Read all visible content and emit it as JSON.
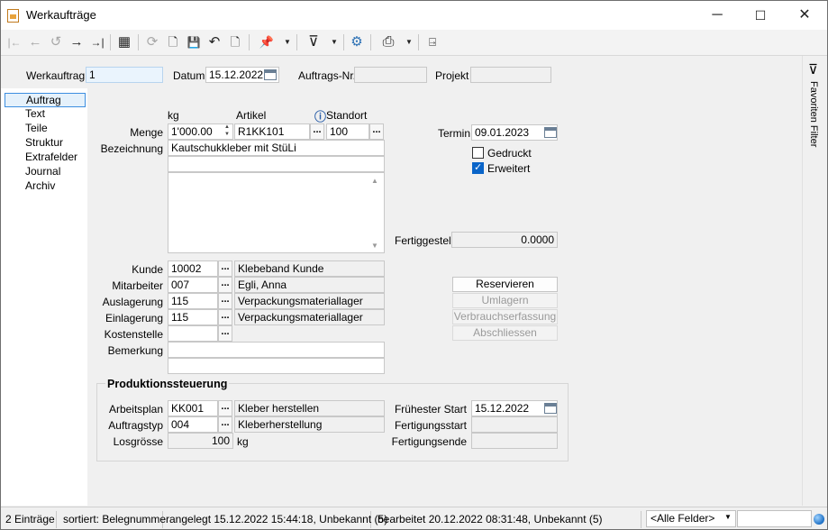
{
  "window": {
    "title": "Werkaufträge",
    "minimize": "─",
    "maximize": "☐",
    "close": "✕"
  },
  "toolbar": {
    "icons": [
      "first-record-icon",
      "previous-record-icon",
      "history-icon",
      "next-record-icon",
      "last-record-icon",
      "table-view-icon",
      "refresh-icon",
      "new-document-icon",
      "save-icon",
      "undo-icon",
      "delete-document-icon",
      "pin-icon",
      "filter-icon",
      "settings-icon",
      "print-icon",
      "exit-icon"
    ],
    "glyphs": {
      "first": "|←",
      "prev": "←",
      "history": "↺",
      "next": "→",
      "last": "→|",
      "table": "▦",
      "refresh": "⟳",
      "new": "🗋",
      "save": "💾",
      "undo": "↶",
      "delete": "🗋",
      "pin": "📌",
      "filter": "⊽",
      "settings": "⚙",
      "print": "⎙",
      "exit": "⍈",
      "dropdown": "▼"
    }
  },
  "header": {
    "werkauftrag_label": "Werkauftrag",
    "werkauftrag_value": "1",
    "datum_label": "Datum",
    "datum_value": "15.12.2022",
    "auftragsnr_label": "Auftrags-Nr.",
    "auftragsnr_value": "",
    "projekt_label": "Projekt",
    "projekt_value": ""
  },
  "nav": {
    "items": [
      {
        "label": "Auftrag",
        "selected": true
      },
      {
        "label": "Text"
      },
      {
        "label": "Teile"
      },
      {
        "label": "Struktur"
      },
      {
        "label": "Extrafelder"
      },
      {
        "label": "Journal"
      },
      {
        "label": "Archiv"
      }
    ]
  },
  "form": {
    "kg_header": "kg",
    "artikel_header": "Artikel",
    "standort_header": "Standort",
    "menge_label": "Menge",
    "menge_value": "1'000.00",
    "artikel_value": "R1KK101",
    "standort_value": "100",
    "bezeichnung_label": "Bezeichnung",
    "bezeichnung_value": "Kautschukkleber mit StüLi",
    "termin_label": "Termin",
    "termin_value": "09.01.2023",
    "gedruckt_label": "Gedruckt",
    "gedruckt_checked": false,
    "erweitert_label": "Erweitert",
    "erweitert_checked": true,
    "fertiggestellt_label": "Fertiggestellt",
    "fertiggestellt_value": "0.0000",
    "kunde_label": "Kunde",
    "kunde_code": "10002",
    "kunde_name": "Klebeband Kunde",
    "mitarbeiter_label": "Mitarbeiter",
    "mitarbeiter_code": "007",
    "mitarbeiter_name": "Egli, Anna",
    "auslagerung_label": "Auslagerung",
    "auslagerung_code": "115",
    "auslagerung_name": "Verpackungsmateriallager",
    "einlagerung_label": "Einlagerung",
    "einlagerung_code": "115",
    "einlagerung_name": "Verpackungsmateriallager",
    "kostenstelle_label": "Kostenstelle",
    "kostenstelle_code": "",
    "bemerkung_label": "Bemerkung",
    "bemerkung_value": "",
    "dots": "..."
  },
  "actions": {
    "reservieren": "Reservieren",
    "umlagern": "Umlagern",
    "verbrauchserfassung": "Verbrauchserfassung",
    "abschliessen": "Abschliessen"
  },
  "produktion": {
    "title": "Produktionssteuerung",
    "arbeitsplan_label": "Arbeitsplan",
    "arbeitsplan_code": "KK001",
    "arbeitsplan_name": "Kleber herstellen",
    "auftragstyp_label": "Auftragstyp",
    "auftragstyp_code": "004",
    "auftragstyp_name": "Kleberherstellung",
    "losgroesse_label": "Losgrösse",
    "losgroesse_value": "100",
    "losgroesse_unit": "kg",
    "fruehester_start_label": "Frühester Start",
    "fruehester_start_value": "15.12.2022",
    "fertigungsstart_label": "Fertigungsstart",
    "fertigungsstart_value": "",
    "fertigungsende_label": "Fertigungsende",
    "fertigungsende_value": ""
  },
  "side_panel": {
    "label": "Favoriten Filter",
    "icon": "⊽"
  },
  "status": {
    "count": "2 Einträge",
    "sorted": "sortiert: Belegnummer",
    "created": "angelegt 15.12.2022 15:44:18, Unbekannt (5)",
    "edited": "bearbeitet 20.12.2022 08:31:48, Unbekannt (5)",
    "field_filter": "<Alle Felder>",
    "search_value": ""
  }
}
